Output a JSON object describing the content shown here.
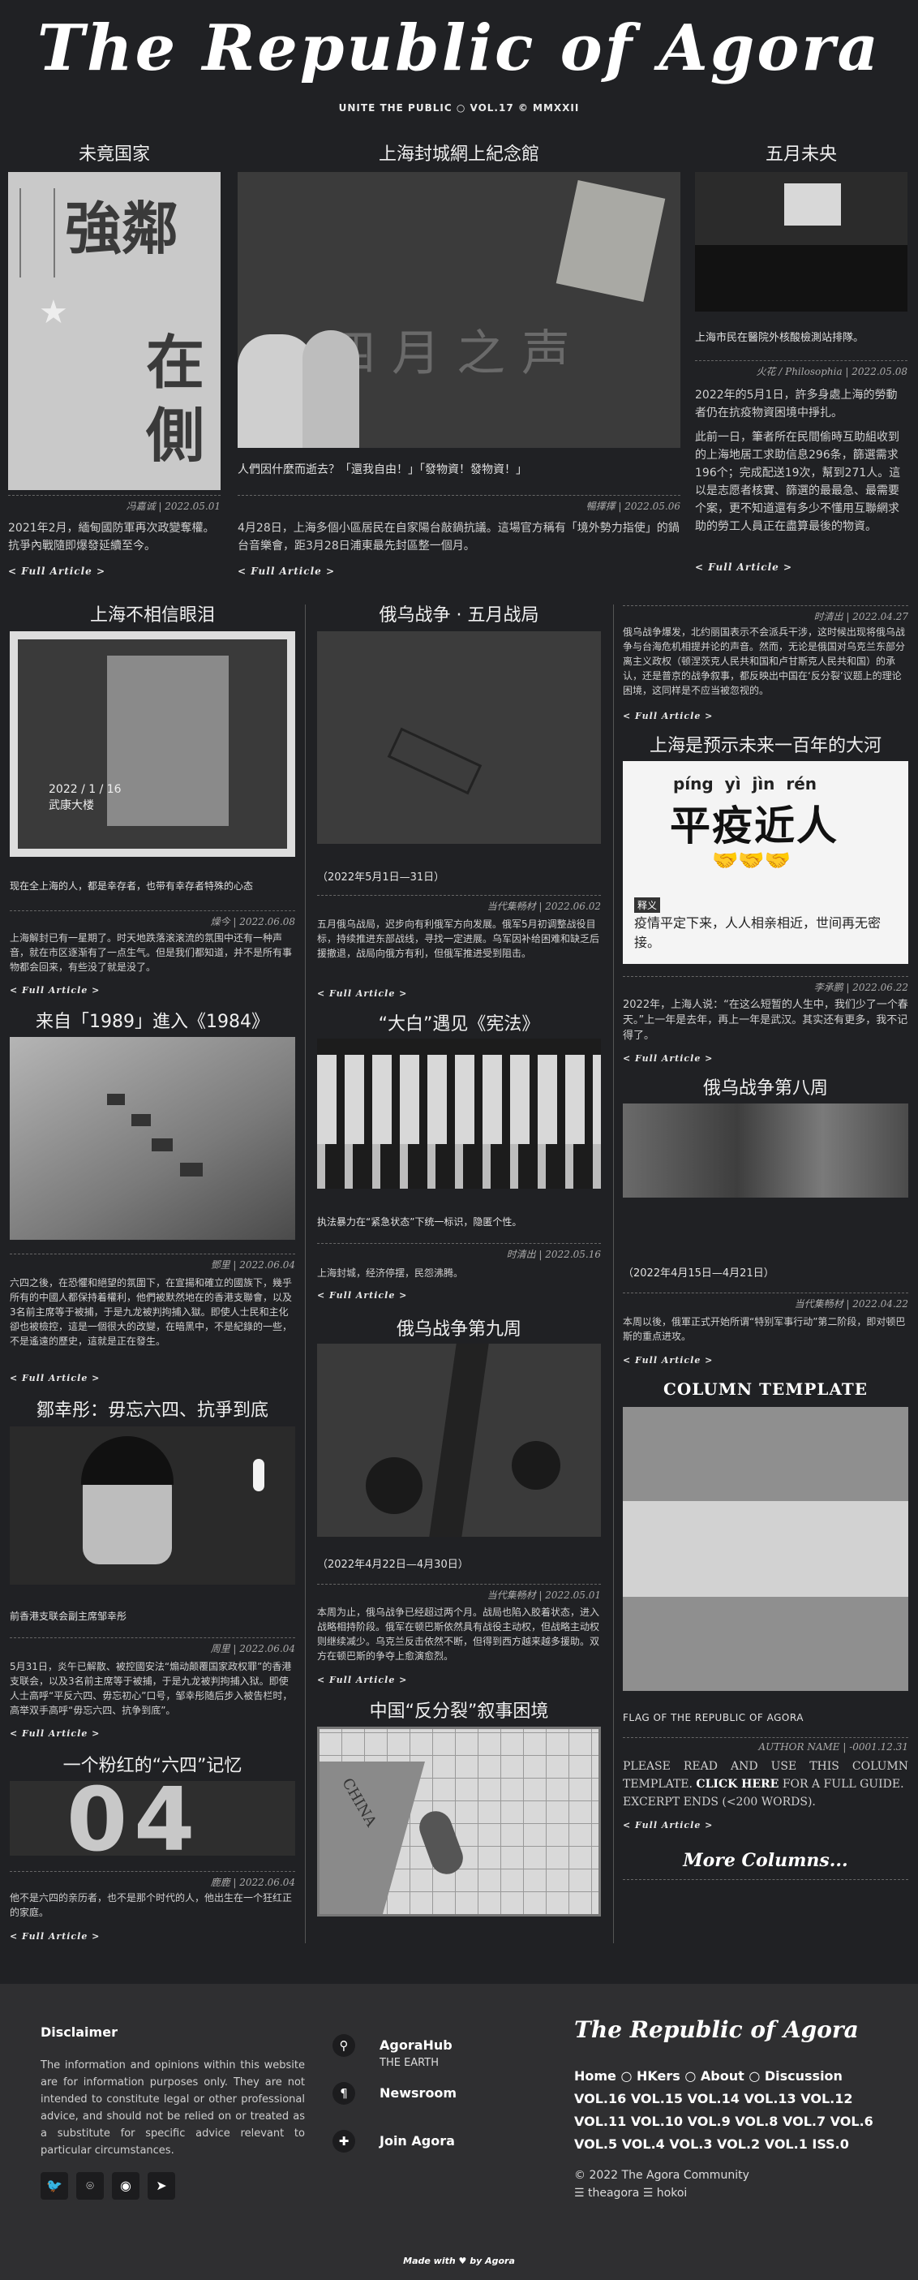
{
  "masthead": {
    "title": "The Republic of Agora",
    "subtitle": "UNITE THE PUBLIC ○ VOL.17 © MMXXII"
  },
  "articles": {
    "a1": {
      "heading": "未竟国家",
      "image_text": "強鄰在側",
      "caption": "",
      "meta": "冯嘉诚 | 2022.05.01",
      "body": "2021年2月，緬甸國防軍再次政變奪權。抗爭內戰隨即爆發延續至今。",
      "more": "< Full Article >"
    },
    "a2": {
      "heading": "上海封城網上紀念館",
      "image_text": "四月之声",
      "caption": "人們因什麼而逝去？「還我自由！」「發物資！發物資！」",
      "meta": "暢擇擇 | 2022.05.06",
      "body": "4月28日，上海多個小區居民在自家陽台敲鍋抗議。這場官方稱有「境外勢力指使」的鍋台音樂會，距3月28日浦東最先封區整一個月。",
      "more": "< Full Article >"
    },
    "a3": {
      "heading": "五月未央",
      "caption": "上海市民在醫院外核酸檢測站排隊。",
      "meta": "火花 / Philosophia | 2022.05.08",
      "body1": "2022年的5月1日，許多身處上海的勞動者仍在抗疫物資困境中掙扎。",
      "body2": "此前一日，筆者所在民間偷時互助組收到的上海地居工求助信息296条，篩選需求196个；完成配送19次，幫到271人。這以是志愿者核實、篩選的最最急、最需要个案，更不知道還有多少不懂用互聯網求助的勞工人員正在盡算最後的物資。",
      "more": "< Full Article >"
    },
    "b1": {
      "heading": "上海不相信眼泪",
      "image_text": "2022 / 1 / 16 武康大楼",
      "caption": "现在全上海的人，都是幸存者，也带有幸存者特殊的心态",
      "meta": "燥今 | 2022.06.08",
      "body": "上海解封已有一星期了。时天地跌落滚滚流的氛围中还有一种声音，就在市区逐渐有了一点生气。但是我们都知道，并不是所有事物都会回来，有些没了就是没了。",
      "more": "< Full Article >"
    },
    "b2": {
      "heading": "俄乌战争 · 五月战局",
      "caption": "（2022年5月1日—31日）",
      "meta": "当代集畅材 | 2022.06.02",
      "body": "五月俄乌战局，迟步向有利俄军方向发展。俄军5月初调整战役目标，持续推进东部战线，寻找一定进展。乌军因补给困难和缺乏后援撤退，战局向俄方有利，但俄军推进受到阻击。",
      "more": "< Full Article >"
    },
    "b3": {
      "meta_top": "时清出 | 2022.04.27",
      "body_top": "俄乌战争爆发，北约丽国表示不会派兵干涉，这时候出现将俄乌战争与台海危机相提并论的声音。然而，无论是俄国对乌克兰东部分离主义政权（顿涅茨克人民共和国和卢甘斯克人民共和国）的承认，还是普京的战争叙事，都反映出中国在‘反分裂’议题上的理论困境，这同样是不应当被忽视的。",
      "more_top": "< Full Article >",
      "heading": "上海是预示未来一百年的大河",
      "image_pinyin": "píng  yì  jìn  rén",
      "image_text": "平疫近人",
      "image_note": "释义",
      "image_body": "疫情平定下来，人人相亲相近，世间再无密接。",
      "meta": "李承鹏 | 2022.06.22",
      "body": "2022年，上海人说：“在这么短暂的人生中，我们少了一个春天。”上一年是去年，再上一年是武汉。其实还有更多，我不记得了。",
      "more": "< Full Article >"
    },
    "c1": {
      "heading": "来自「1989」進入《1984》",
      "meta": "鄧里 | 2022.06.04",
      "body": "六四之後，在恐懼和絕望的氛圍下，在宣揚和確立的國族下，幾乎所有的中國人都保持着權利，他們被默然地在的香港支聯會，以及3名前主席等于被捕，于是九龙被判拘捕入獄。即使人士民和主化卻也被檢控，這是一個很大的改變，在暗黑中，不是紀錄的一些，不是遙遠的歷史，這就是正在發生。",
      "more": "< Full Article >"
    },
    "c2": {
      "heading": "“大白”遇见《宪法》",
      "caption": "执法暴力在“紧急状态”下统一标识，隐匿个性。",
      "meta": "时清出 | 2022.05.16",
      "body": "上海封城，经济停摆，民怨沸腾。",
      "more": "< Full Article >"
    },
    "c3": {
      "heading": "俄乌战争第八周",
      "caption": "（2022年4月15日—4月21日）",
      "meta": "当代集畅材 | 2022.04.22",
      "body": "本周以後，俄軍正式开始所谓“特别军事行动”第二阶段，即对顿巴斯的重点进攻。",
      "more": "< Full Article >"
    },
    "d1": {
      "heading": "鄒幸彤：毋忘六四、抗爭到底",
      "caption": "前香港支联会副主席邹幸彤",
      "meta": "周里 | 2022.06.04",
      "body": "5月31日，炎午已解散、被控國安法“煽动颠覆国家政权罪”的香港支联会，以及3名前主席等于被捕，于是九龙被判拘捕入狱。即使人士高呼“平反六四、毋忘初心”口号，邹幸彤随后步入被告栏时，高举双手高呼“毋忘六四、抗争到底”。",
      "more": "< Full Article >"
    },
    "d2": {
      "heading": "俄乌战争第九周",
      "caption": "（2022年4月22日—4月30日）",
      "meta": "当代集畅材 | 2022.05.01",
      "body": "本周为止，俄乌战争已经超过两个月。战局也陷入胶着状态，进入战略相持阶段。俄军在顿巴斯依然具有战役主动权，但战略主动权则继续减少。乌克兰反击依然不断，但得到西方越来越多援助。双方在顿巴斯的争夺上愈演愈烈。",
      "more": "< Full Article >"
    },
    "d3": {
      "heading": "COLUMN TEMPLATE",
      "caption": "FLAG OF THE REPUBLIC OF AGORA",
      "meta": "AUTHOR NAME | -0001.12.31",
      "body_a": "PLEASE READ AND USE THIS COLUMN TEMPLATE.",
      "body_link": "CLICK HERE",
      "body_b": "FOR A FULL GUIDE.",
      "body2": "EXCERPT ENDS (<200 WORDS).",
      "more": "< Full Article >"
    },
    "e1": {
      "heading": "一个粉红的“六四”记忆",
      "image_text": "04",
      "meta": "鹿鹿 | 2022.06.04",
      "body": "他不是六四的亲历者，也不是那个时代的人，他出生在一个狂红正的家庭。",
      "more": "< Full Article >"
    },
    "e2": {
      "heading": "中国“反分裂”叙事困境",
      "image_text": "CHINA"
    },
    "e3": {
      "heading": "More Columns..."
    }
  },
  "colors": {
    "page_bg": "#202124",
    "footer_bg": "#2f2f31",
    "flag_top": "#8f8f8f",
    "flag_mid": "#d2d2d2",
    "flag_bot": "#8f8f8f"
  },
  "footer": {
    "disclaimer_title": "Disclaimer",
    "disclaimer_text": "The information and opinions within this website are for information purposes only. They are not intended to constitute legal or other professional advice, and should not be relied on or treated as a substitute for specific advice relevant to particular circumstances.",
    "social": [
      "twitter-icon",
      "github-icon",
      "reddit-icon",
      "telegram-icon"
    ],
    "nav": [
      {
        "label": "AgoraHub",
        "sub": "THE EARTH",
        "icon": "location-icon"
      },
      {
        "label": "Newsroom",
        "sub": "",
        "icon": "paragraph-icon"
      },
      {
        "label": "Join Agora",
        "sub": "",
        "icon": "puzzle-icon"
      }
    ],
    "brand": "The Republic of Agora",
    "links_line1": "Home ○ HKers ○ About ○ Discussion",
    "links_line2": "VOL.16  VOL.15  VOL.14  VOL.13  VOL.12",
    "links_line3": "VOL.11 VOL.10 VOL.9 VOL.8 VOL.7 VOL.6",
    "links_line4": "VOL.5 VOL.4 VOL.3 VOL.2 VOL.1 ISS.0",
    "copyright": "© 2022 The Agora Community",
    "credits": "☰ theagora ☰ hokoi",
    "made_with": "Made with ♥ by Agora"
  }
}
